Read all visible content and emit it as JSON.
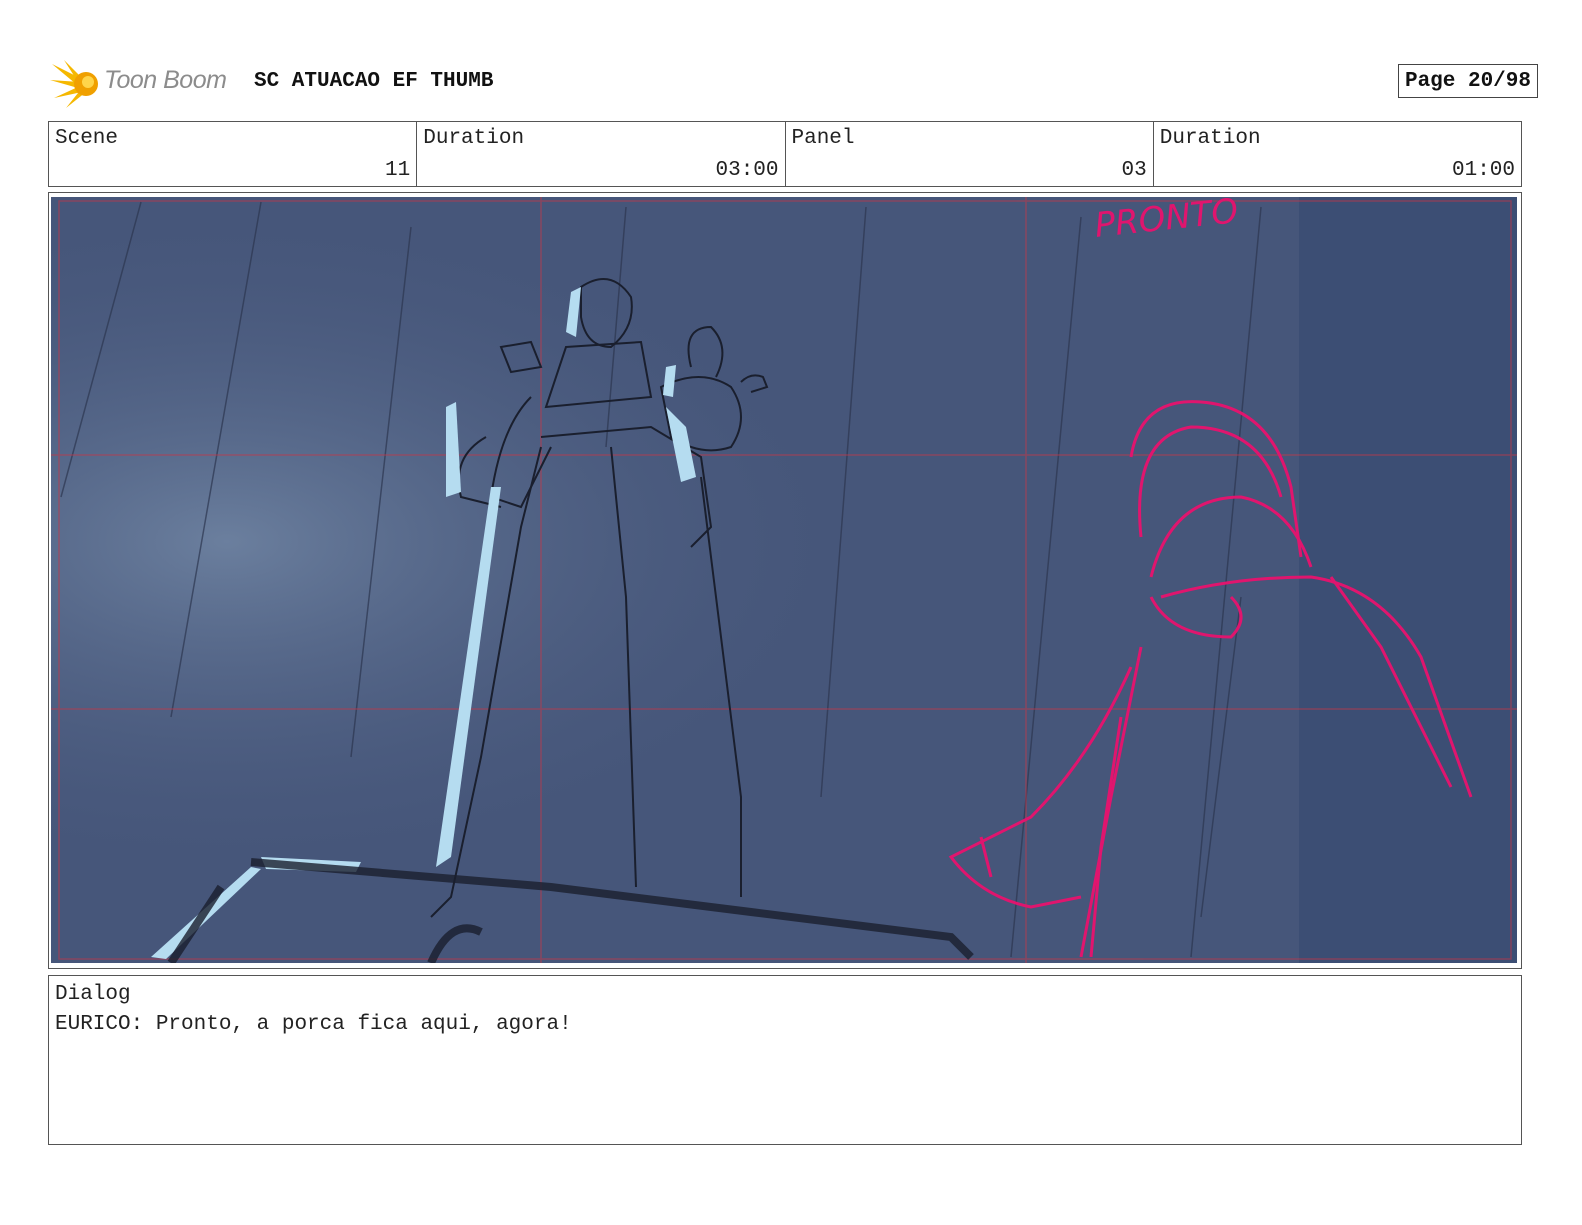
{
  "header": {
    "brand": "Toon Boom",
    "title": "SC ATUACAO EF THUMB",
    "page_label": "Page 20/98"
  },
  "info": {
    "scene_label": "Scene",
    "scene_value": "11",
    "duration_label": "Duration",
    "duration_value": "03:00",
    "panel_label": "Panel",
    "panel_value": "03",
    "panel_duration_label": "Duration",
    "panel_duration_value": "01:00"
  },
  "panel": {
    "sketch_note": "PRONTO",
    "background_color": "#46567a",
    "highlight_color": "#b5dcf0",
    "pink_color": "#e0156e"
  },
  "dialog": {
    "label": "Dialog",
    "text": "EURICO: Pronto, a porca fica aqui, agora!"
  }
}
